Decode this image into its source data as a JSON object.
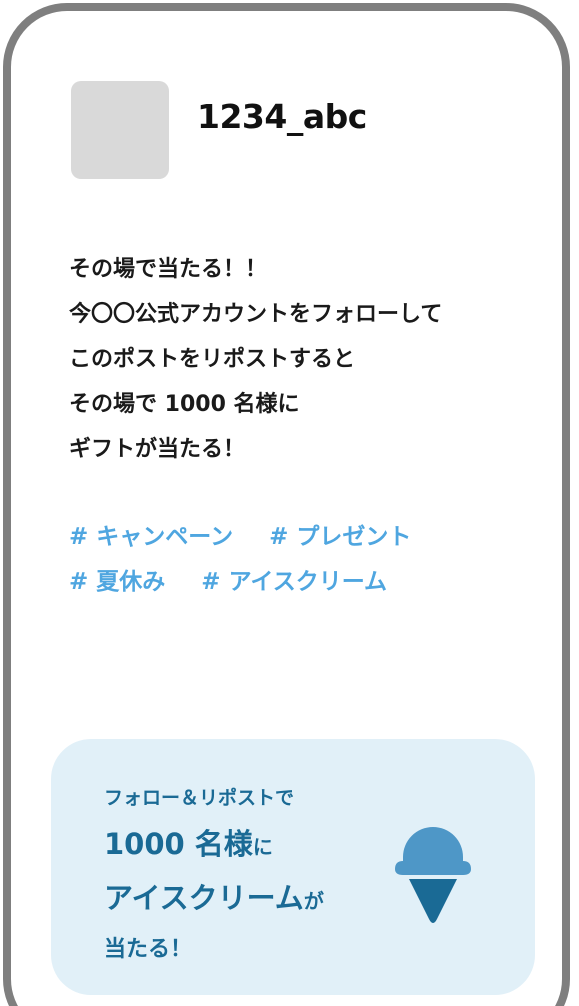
{
  "profile": {
    "username": "1234_abc"
  },
  "post": {
    "lines": [
      "その場で当たる！！",
      "今〇〇公式アカウントをフォローして",
      "このポストをリポストすると",
      "その場で 1000 名様に",
      "ギフトが当たる！"
    ],
    "hashtags_row1": [
      "# キャンペーン",
      "# プレゼント"
    ],
    "hashtags_row2": [
      "# 夏休み",
      "# アイスクリーム"
    ]
  },
  "promo": {
    "subtitle": "フォロー＆リポストで",
    "line1_main": "1000 名様",
    "line1_suffix": "に",
    "line2_main": "アイスクリーム",
    "line2_suffix": "が",
    "line3": "当たる！"
  },
  "icons": {
    "promo_icon": "ice-cream-icon"
  },
  "colors": {
    "frame": "#7f7f7f",
    "avatar": "#d9d9d9",
    "hashtag": "#4fa6e0",
    "promo_bg": "#e1f0f8",
    "promo_text": "#1a6a95",
    "icecream_scoop": "#4e97c7",
    "icecream_cone": "#1a6a95"
  }
}
